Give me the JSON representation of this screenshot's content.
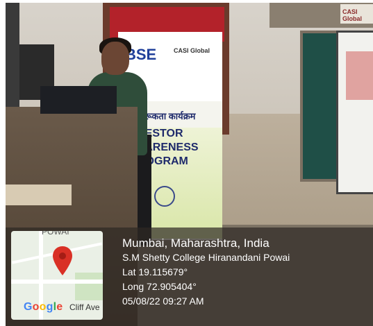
{
  "photo": {
    "banner": {
      "logo_text": "BSE",
      "partner_text": "CASI Global",
      "hindi_text": "जागरूकता कार्यक्रम",
      "program_lines": [
        "VESTOR",
        "WARENESS",
        "ROGRAM"
      ]
    },
    "sign_text": "CASI Global"
  },
  "geotag": {
    "map": {
      "area_label": "POWAI",
      "street_label": "Cliff Ave",
      "brand": "Google",
      "pin_color": "#d93025"
    },
    "location": "Mumbai, Maharashtra, India",
    "place": "S.M Shetty College Hiranandani Powai",
    "lat": "Lat 19.115679°",
    "long": "Long 72.905404°",
    "datetime": "05/08/22 09:27 AM"
  }
}
